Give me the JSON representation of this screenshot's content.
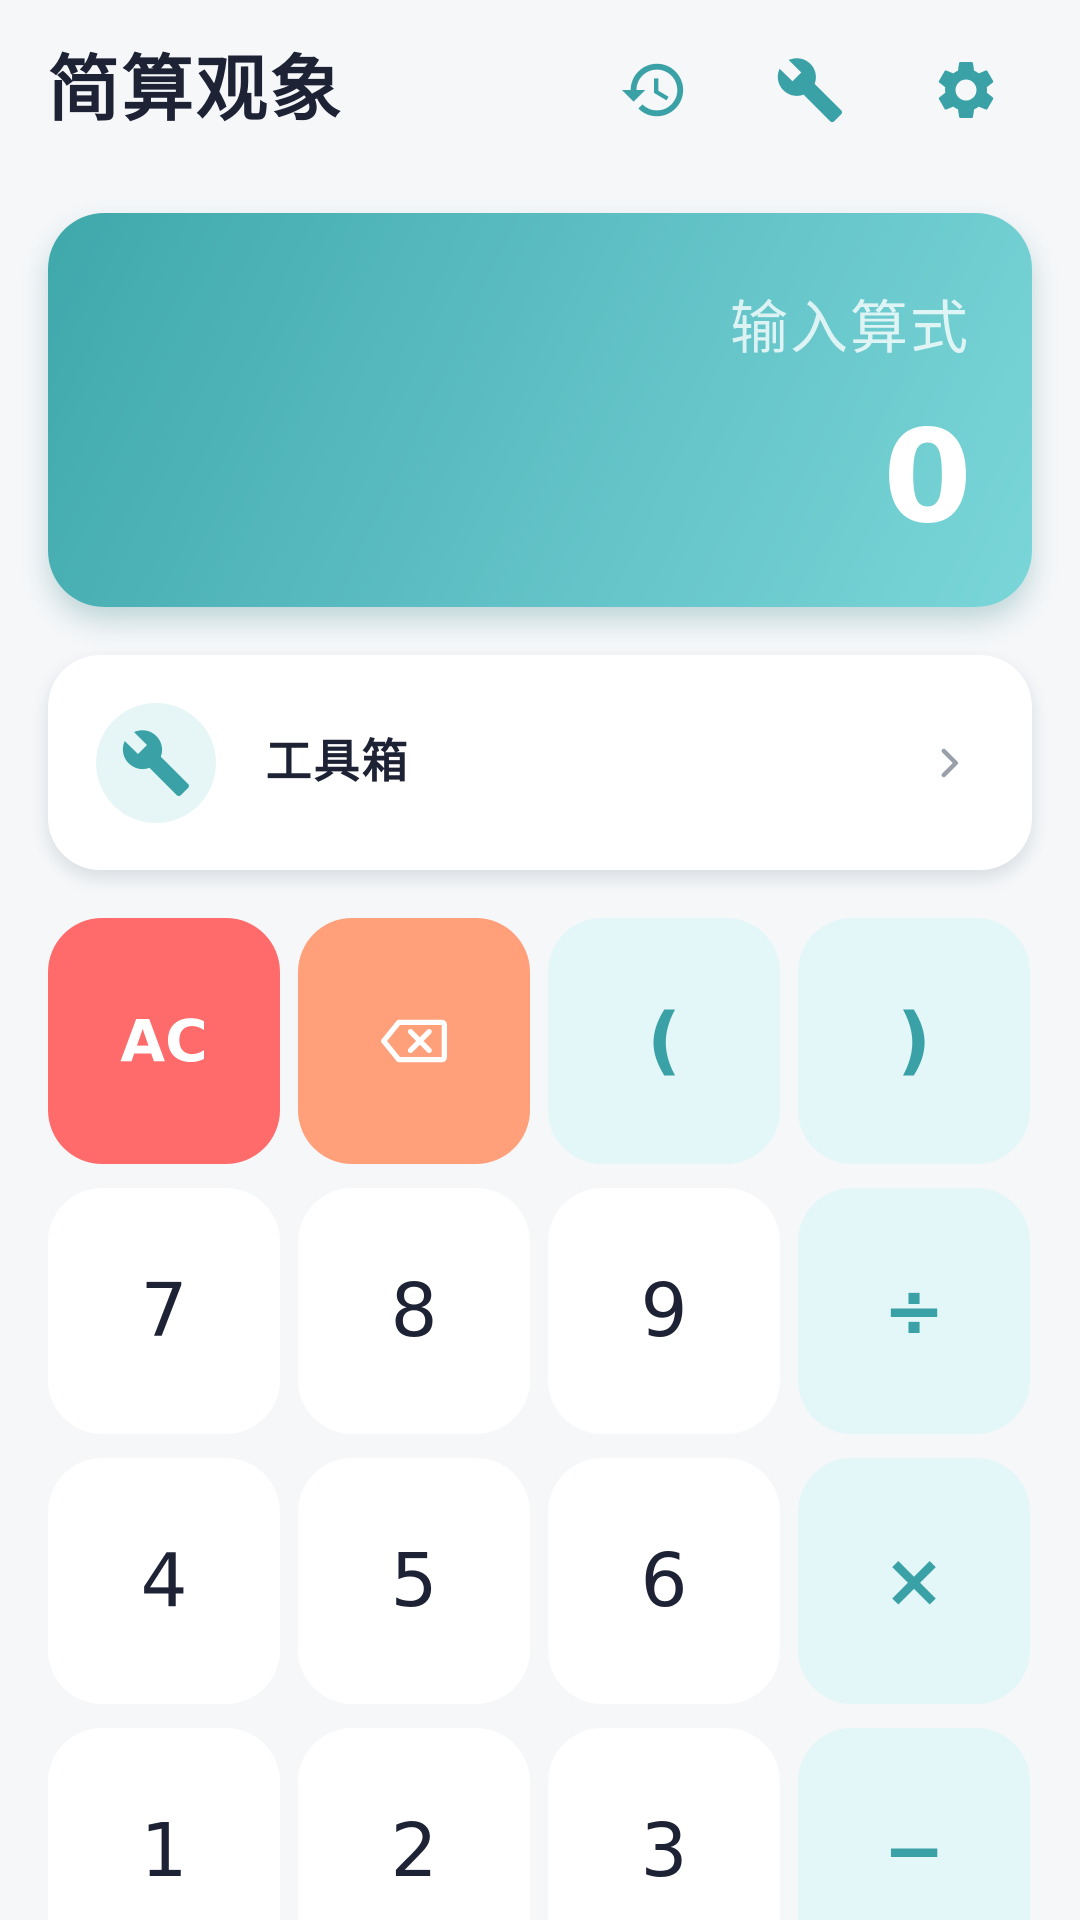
{
  "header": {
    "title": "简算观象",
    "icons": {
      "history": "history-icon",
      "tools": "wrench-icon",
      "settings": "gear-icon"
    }
  },
  "display": {
    "placeholder": "输入算式",
    "result": "0"
  },
  "toolbox": {
    "label": "工具箱",
    "icon": "wrench-icon"
  },
  "keypad": {
    "clear": "AC",
    "backspace_icon": "backspace-icon",
    "open_paren": "(",
    "close_paren": ")",
    "seven": "7",
    "eight": "8",
    "nine": "9",
    "divide": "÷",
    "four": "4",
    "five": "5",
    "six": "6",
    "multiply": "×",
    "one": "1",
    "two": "2",
    "three": "3",
    "minus": "−"
  },
  "colors": {
    "accent": "#3aa2a6",
    "gradient_start": "#3fa8ab",
    "gradient_end": "#7ad6d8",
    "clear": "#ff6b6b",
    "backspace": "#ffa07a",
    "operator_bg": "#e3f6f8",
    "background": "#f5f7f9",
    "text": "#1e2235"
  }
}
